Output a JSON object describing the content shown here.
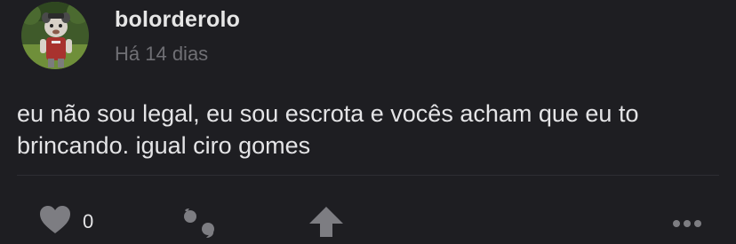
{
  "post": {
    "username": "bolorderolo",
    "timestamp": "Há 14 dias",
    "text": "eu não sou legal, eu sou escrota e vocês acham que eu to brincando. igual ciro gomes",
    "likes": "0"
  },
  "icons": {
    "like": "heart-icon",
    "comment": "quote-icon",
    "share": "arrow-up-icon",
    "more": "more-dots-icon"
  },
  "colors": {
    "background": "#1e1e22",
    "text": "#e4e4e6",
    "muted": "#6f6f74",
    "icon": "#7d7d82"
  }
}
